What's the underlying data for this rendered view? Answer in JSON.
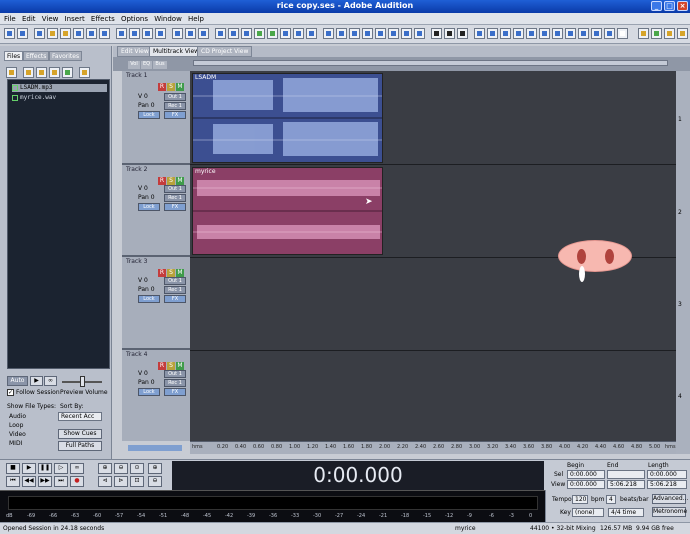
{
  "app": {
    "title": "rice copy.ses - Adobe Audition"
  },
  "menu": [
    "File",
    "Edit",
    "View",
    "Insert",
    "Effects",
    "Options",
    "Window",
    "Help"
  ],
  "left_panel": {
    "tabs": [
      "Files",
      "Effects",
      "Favorites"
    ],
    "files": [
      "LSADM.mp3",
      "myrice.wav"
    ],
    "auto_play": "Auto",
    "follow_session": "Follow Session",
    "preview_volume": "Preview Volume",
    "show_file_types": "Show File Types:",
    "sort_by": "Sort By:",
    "sort_value": "Recent Acc",
    "file_types": [
      "Audio",
      "Loop",
      "Video",
      "MIDI"
    ],
    "show_cues": "Show Cues",
    "full_paths": "Full Paths"
  },
  "view_tabs": [
    "Edit View",
    "Multitrack View",
    "CD Project View"
  ],
  "header_tabs": [
    "Vol",
    "EQ",
    "Bus"
  ],
  "tracks": [
    {
      "name": "Track 1",
      "clip": "LSADM",
      "vol": "V 0",
      "pan": "Pan 0",
      "out": "Out 1",
      "rec": "Rec 1",
      "lock": "Lock",
      "fx": "FX"
    },
    {
      "name": "Track 2",
      "clip": "myrice",
      "vol": "V 0",
      "pan": "Pan 0",
      "out": "Out 1",
      "rec": "Rec 1",
      "lock": "Lock",
      "fx": "FX"
    },
    {
      "name": "Track 3",
      "clip": "",
      "vol": "V 0",
      "pan": "Pan 0",
      "out": "Out 1",
      "rec": "Rec 1",
      "lock": "Lock",
      "fx": "FX"
    },
    {
      "name": "Track 4",
      "clip": "",
      "vol": "V 0",
      "pan": "Pan 0",
      "out": "Out 1",
      "rec": "Rec 1",
      "lock": "Lock",
      "fx": "FX"
    }
  ],
  "rsm": [
    "R",
    "S",
    "M"
  ],
  "ruler": [
    "hms",
    "0.20",
    "0.40",
    "0.60",
    "0.80",
    "1.00",
    "1.20",
    "1.40",
    "1.60",
    "1.80",
    "2.00",
    "2.20",
    "2.40",
    "2.60",
    "2.80",
    "3.00",
    "3.20",
    "3.40",
    "3.60",
    "3.80",
    "4.00",
    "4.20",
    "4.40",
    "4.60",
    "4.80",
    "5.00",
    "hms"
  ],
  "vscale": [
    "1",
    "2",
    "3",
    "4"
  ],
  "transport": {
    "time": "0:00.000"
  },
  "selection": {
    "headers": [
      "Begin",
      "End",
      "Length"
    ],
    "sel_label": "Sel",
    "view_label": "View",
    "sel": [
      "0:00.000",
      "",
      "0:00.000"
    ],
    "view": [
      "0:00.000",
      "5:06.218",
      "5:06.218"
    ]
  },
  "tempo": {
    "tempo_label": "Tempo",
    "tempo": "120",
    "bpm": "bpm",
    "beats": "4",
    "beats_label": "beats/bar",
    "key_label": "Key",
    "key": "(none)",
    "time_sig": "4/4 time",
    "advanced": "Advanced...",
    "metronome": "Metronome"
  },
  "levels": [
    "dB",
    "-69",
    "-66",
    "-63",
    "-60",
    "-57",
    "-54",
    "-51",
    "-48",
    "-45",
    "-42",
    "-39",
    "-36",
    "-33",
    "-30",
    "-27",
    "-24",
    "-21",
    "-18",
    "-15",
    "-12",
    "-9",
    "-6",
    "-3",
    "0"
  ],
  "status": {
    "left": "Opened Session in 24.18 seconds",
    "clip": "myrice",
    "format": "44100 • 32-bit Mixing",
    "size": "126.57 MB",
    "free": "9.94 GB free"
  },
  "colors": {
    "track1_clip": "#3c4f91",
    "track2_clip": "#8b3f66",
    "background": "#3a3d44"
  }
}
